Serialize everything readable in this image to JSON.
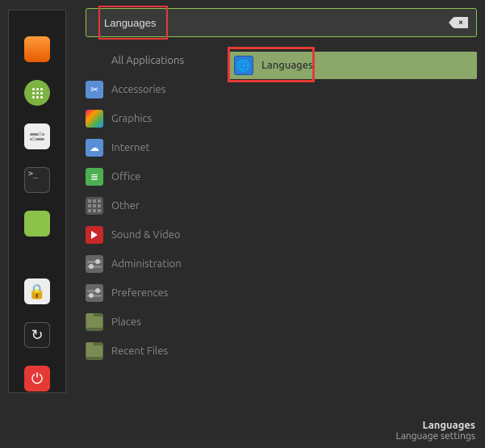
{
  "search": {
    "value": "Languages"
  },
  "categories": [
    {
      "key": "all",
      "label": "All Applications",
      "iconClass": "cat-allapps",
      "labelClass": "cat-allapps-label"
    },
    {
      "key": "accessories",
      "label": "Accessories",
      "iconClass": "cat-accessories",
      "glyph": "✂"
    },
    {
      "key": "graphics",
      "label": "Graphics",
      "iconClass": "cat-graphics"
    },
    {
      "key": "internet",
      "label": "Internet",
      "iconClass": "cat-internet",
      "glyph": "☁"
    },
    {
      "key": "office",
      "label": "Office",
      "iconClass": "cat-office",
      "glyph": "≣"
    },
    {
      "key": "other",
      "label": "Other",
      "iconClass": "cat-other",
      "gridIcon": true
    },
    {
      "key": "sound",
      "label": "Sound & Video",
      "iconClass": "cat-sound"
    },
    {
      "key": "admin",
      "label": "Administration",
      "iconClass": "cat-admin",
      "slidersIcon": true
    },
    {
      "key": "prefs",
      "label": "Preferences",
      "iconClass": "cat-prefs",
      "slidersIcon": true
    },
    {
      "key": "places",
      "label": "Places",
      "iconClass": "cat-places",
      "folderIcon": true
    },
    {
      "key": "recent",
      "label": "Recent Files",
      "iconClass": "cat-recent",
      "folderIcon": true
    }
  ],
  "results": [
    {
      "key": "languages",
      "label": "Languages",
      "iconGlyph": "🌐",
      "highlighted": true
    }
  ],
  "footer": {
    "title": "Languages",
    "subtitle": "Language settings"
  },
  "sidebar": [
    {
      "name": "firefox-icon",
      "cls": "side-firefox",
      "glyph": ""
    },
    {
      "name": "apps-icon",
      "cls": "side-apps",
      "dots": true
    },
    {
      "name": "settings-icon",
      "cls": "side-settings",
      "sliders": true
    },
    {
      "name": "terminal-icon",
      "cls": "side-terminal",
      "glyph": ">_"
    },
    {
      "name": "files-icon",
      "cls": "side-files",
      "folder": true
    },
    {
      "name": "lock-icon",
      "cls": "side-lock gap-extra",
      "glyph": "🔒"
    },
    {
      "name": "reload-icon",
      "cls": "side-reload",
      "glyph": "↻"
    },
    {
      "name": "power-icon",
      "cls": "side-power",
      "glyph": "⏻"
    }
  ]
}
